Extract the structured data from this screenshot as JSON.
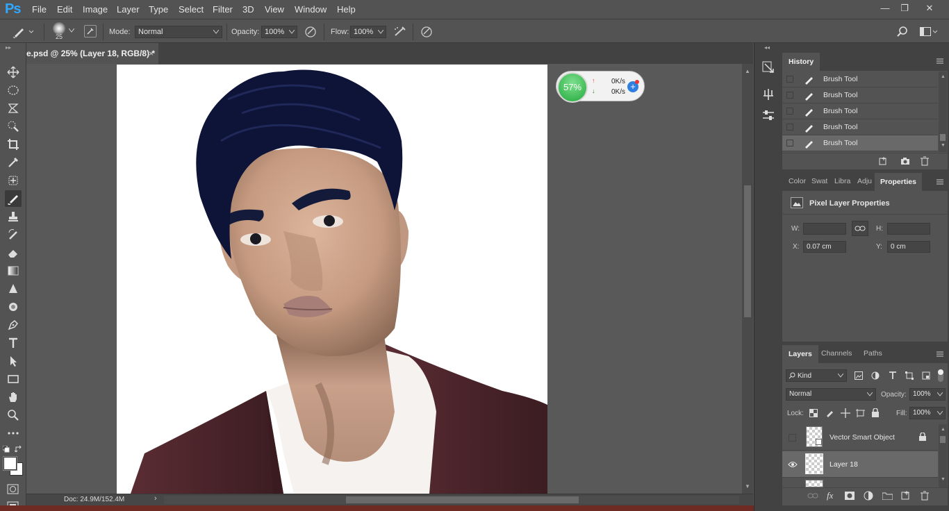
{
  "app": {
    "logo": "Ps"
  },
  "menu": [
    "File",
    "Edit",
    "Image",
    "Layer",
    "Type",
    "Select",
    "Filter",
    "3D",
    "View",
    "Window",
    "Help"
  ],
  "window_controls": {
    "minimize": "—",
    "restore": "❐",
    "close": "✕"
  },
  "options": {
    "brush_size": "25",
    "mode_label": "Mode:",
    "mode_value": "Normal",
    "opacity_label": "Opacity:",
    "opacity_value": "100%",
    "flow_label": "Flow:",
    "flow_value": "100%"
  },
  "document_tab": {
    "title": "e.psd @ 25% (Layer 18, RGB/8) *",
    "close": "×"
  },
  "status": {
    "doc": "Doc: 24.9M/152.4M"
  },
  "net_widget": {
    "percent": "57%",
    "up": "0K/s",
    "down": "0K/s"
  },
  "history": {
    "title": "History",
    "items": [
      "Brush Tool",
      "Brush Tool",
      "Brush Tool",
      "Brush Tool",
      "Brush Tool"
    ]
  },
  "properties": {
    "tabs": [
      "Color",
      "Swat",
      "Libra",
      "Adju",
      "Properties"
    ],
    "heading": "Pixel Layer Properties",
    "w_label": "W:",
    "w_value": "",
    "h_label": "H:",
    "h_value": "",
    "x_label": "X:",
    "x_value": "0.07 cm",
    "y_label": "Y:",
    "y_value": "0 cm"
  },
  "layers": {
    "tabs": [
      "Layers",
      "Channels",
      "Paths"
    ],
    "kind_value": "Kind",
    "blend_value": "Normal",
    "opacity_label": "Opacity:",
    "opacity_value": "100%",
    "lock_label": "Lock:",
    "fill_label": "Fill:",
    "fill_value": "100%",
    "items": [
      {
        "name": "Vector Smart Object",
        "visible": false,
        "locked": true,
        "selected": false
      },
      {
        "name": "Layer 18",
        "visible": true,
        "locked": false,
        "selected": true
      }
    ]
  },
  "colors": {
    "accent": "#31a8ff",
    "panel_bg": "#535353",
    "dark_bg": "#424242",
    "selected_row": "#696969"
  }
}
